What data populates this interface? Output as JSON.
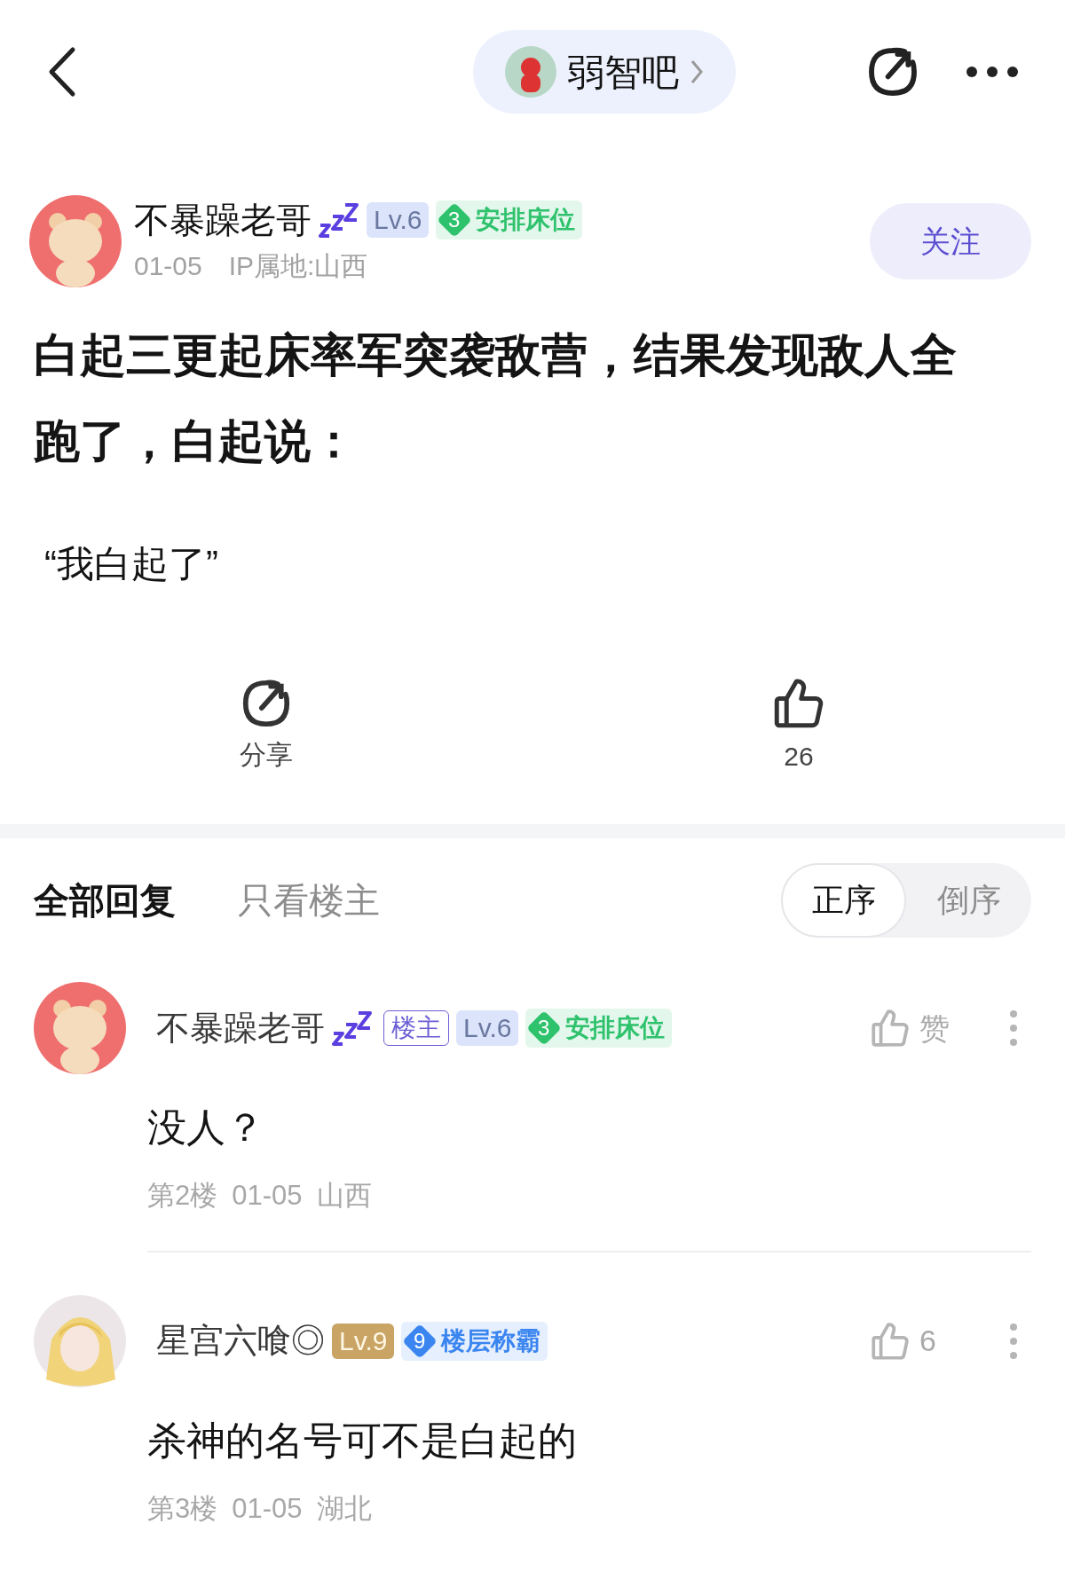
{
  "header": {
    "forum_name": "弱智吧"
  },
  "post": {
    "author": {
      "name": "不暴躁老哥",
      "level": {
        "text": "Lv.6",
        "kind": "standard"
      },
      "badge": {
        "number": "3",
        "text": "安排床位",
        "color": "#2fc26d"
      }
    },
    "date": "01-05",
    "ip": "IP属地:山西",
    "follow_label": "关注",
    "title": "白起三更起床率军突袭敌营，结果发现敌人全跑了，白起说：",
    "body": "“我白起了”",
    "share_label": "分享",
    "like_count": "26"
  },
  "reply_tabs": [
    {
      "label": "全部回复",
      "selected": true
    },
    {
      "label": "只看楼主",
      "selected": false
    }
  ],
  "sort_options": [
    {
      "label": "正序",
      "selected": true
    },
    {
      "label": "倒序",
      "selected": false
    }
  ],
  "comments": [
    {
      "author": "不暴躁老哥",
      "sleeping": true,
      "op_label": "楼主",
      "level": {
        "text": "Lv.6",
        "kind": "standard"
      },
      "badge": {
        "number": "3",
        "text": "安排床位",
        "color": "#2fc26d"
      },
      "like_label": "赞",
      "content": "没人？",
      "floor": "第2楼",
      "date": "01-05",
      "location": "山西"
    },
    {
      "author": "星宫六喰◎",
      "sleeping": false,
      "level": {
        "text": "Lv.9",
        "kind": "gold"
      },
      "badge": {
        "number": "9",
        "text": "楼层称霸",
        "color": "#3a85f0"
      },
      "like_label": "6",
      "content": "杀神的名号可不是白起的",
      "floor": "第3楼",
      "date": "01-05",
      "location": "湖北"
    }
  ]
}
